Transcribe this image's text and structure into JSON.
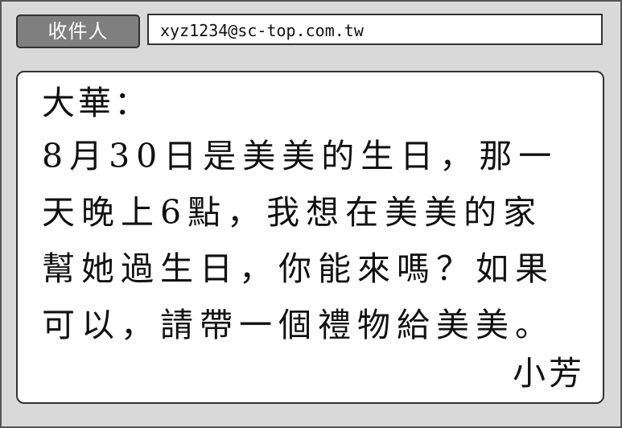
{
  "recipient": {
    "label": "收件人",
    "value": "xyz1234@sc-top.com.tw"
  },
  "message": {
    "greeting": "大華：",
    "lines": [
      "8月30日是美美的生日，那一",
      "天晚上6點，我想在美美的家",
      "幫她過生日，你能來嗎？如果",
      "可以，請帶一個禮物給美美。"
    ],
    "signature": "小芳"
  }
}
